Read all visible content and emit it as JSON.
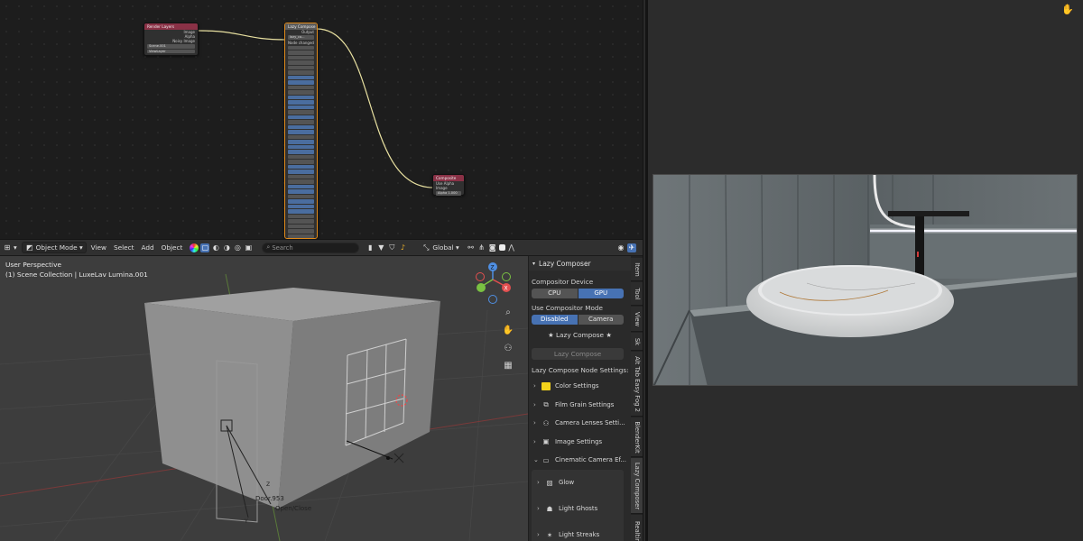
{
  "nodes": {
    "render_layers": {
      "title": "Render Layers",
      "outputs": [
        "Image",
        "Alpha",
        "Noisy Image"
      ],
      "scene": "Scene.001",
      "view_layer": "ViewLayer"
    },
    "lazy": {
      "title": "Lazy Compose",
      "output_label": "Output",
      "selector": "lazy_co...",
      "section": "Node changed"
    },
    "composite": {
      "title": "Composite",
      "use_alpha": "Use Alpha",
      "image_label": "Image",
      "alpha_label": "Alpha",
      "alpha_value": "1.000"
    }
  },
  "header": {
    "mode": "Object Mode",
    "menu": [
      "View",
      "Select",
      "Add",
      "Object"
    ],
    "search_placeholder": "Search",
    "transform_orientation": "Global"
  },
  "viewport": {
    "perspective": "User Perspective",
    "collection": "(1) Scene Collection | LuxeLav Lumina.001",
    "door_label": "Door.953",
    "open_close_label": "Open/Close",
    "axis_x": "X",
    "axis_y": "Y",
    "axis_z": "Z"
  },
  "npanel": {
    "title": "Lazy Composer",
    "device_label": "Compositor Device",
    "device_options": [
      "CPU",
      "GPU"
    ],
    "mode_label": "Use Compositor Mode",
    "mode_options": [
      "Disabled",
      "Camera"
    ],
    "brand": "★ Lazy Compose ★",
    "compose_button": "Lazy Compose",
    "settings_label": "Lazy Compose Node Settings:",
    "items": [
      "Color Settings",
      "Film Grain Settings",
      "Camera Lenses Setti...",
      "Image Settings",
      "Cinematic Camera Ef..."
    ],
    "sub_items": [
      "Glow",
      "Light Ghosts",
      "Light Streaks"
    ]
  },
  "vertical_tabs": [
    "Item",
    "Tool",
    "View",
    "Sk",
    "Alt Tab Easy Fog 2",
    "BlenderKit",
    "Lazy Composer",
    "Realtime"
  ],
  "colors": {
    "accent": "#4772b3",
    "lazy_node_border": "#e08a1a",
    "link": "#e8e0a0",
    "node_header_red": "#8a3146"
  }
}
